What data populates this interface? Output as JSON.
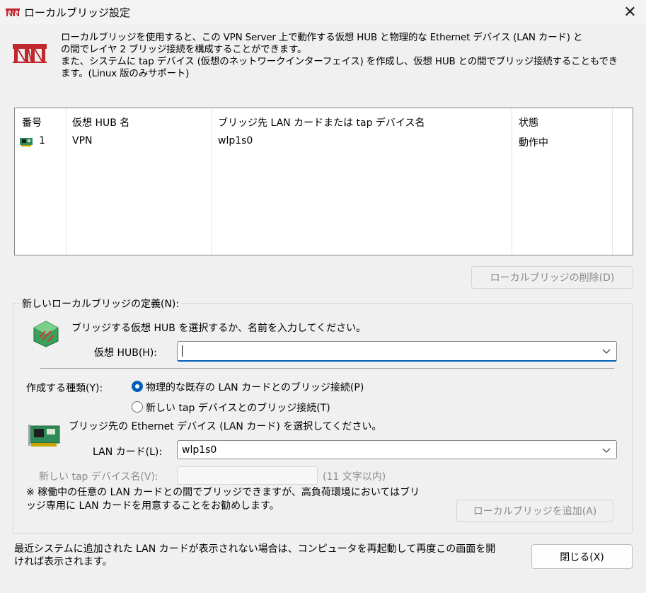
{
  "window": {
    "title": "ローカルブリッジ設定",
    "close_glyph": "✕"
  },
  "description": {
    "lines": [
      "ローカルブリッジを使用すると、この VPN Server 上で動作する仮想 HUB と物理的な Ethernet デバイス (LAN カード) と",
      "の間でレイヤ 2 ブリッジ接続を構成することができます。",
      "また、システムに tap デバイス (仮想のネットワークインターフェイス) を作成し、仮想 HUB との間でブリッジ接続することもでき",
      "ます。(Linux 版のみサポート)"
    ]
  },
  "bridge_list": {
    "columns": [
      "番号",
      "仮想 HUB 名",
      "ブリッジ先 LAN カードまたは tap デバイス名",
      "状態"
    ],
    "rows": [
      {
        "number": "1",
        "hub": "VPN",
        "device": "wlp1s0",
        "status": "動作中"
      }
    ]
  },
  "delete_button": {
    "label": "ローカルブリッジの削除(D)",
    "enabled": false
  },
  "new_bridge": {
    "group_label": "新しいローカルブリッジの定義(N):",
    "hub_prompt": "ブリッジする仮想 HUB を選択するか、名前を入力してください。",
    "hub_label": "仮想 HUB(H):",
    "hub_value": "",
    "type_label": "作成する種類(Y):",
    "radio_physical": {
      "label": "物理的な既存の LAN カードとのブリッジ接続(P)",
      "checked": true
    },
    "radio_tap": {
      "label": "新しい tap デバイスとのブリッジ接続(T)",
      "checked": false
    },
    "lan_prompt": "ブリッジ先の Ethernet デバイス (LAN カード) を選択してください。",
    "lan_label": "LAN カード(L):",
    "lan_value": "wlp1s0",
    "tap_label": "新しい tap デバイス名(V):",
    "tap_value": "",
    "tap_hint": "(11 文字以内)",
    "note_lines": [
      "※ 稼働中の任意の LAN カードとの間でブリッジできますが、高負荷環境においてはブリ",
      "ッジ専用に LAN カードを用意することをお勧めします。"
    ],
    "add_button": {
      "label": "ローカルブリッジを追加(A)",
      "enabled": false
    }
  },
  "footer": {
    "note_lines": [
      "最近システムに追加された LAN カードが表示されない場合は、コンピュータを再起動して再度この画面を開",
      "ければ表示されます。"
    ],
    "close_button_label": "閉じる(X)"
  },
  "colors": {
    "accent": "#005fb8",
    "disabled_text": "#8a8a8a",
    "window_bg": "#f0f0f0"
  },
  "icons": {
    "app": "bridge-icon",
    "hub": "virtual-hub-icon",
    "nic": "network-card-icon",
    "dropdown": "chevron-down-icon",
    "close": "close-icon"
  }
}
